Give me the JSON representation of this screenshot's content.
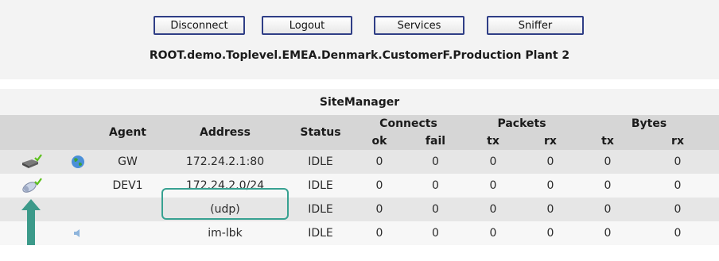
{
  "toolbar": {
    "disconnect_label": "Disconnect",
    "logout_label": "Logout",
    "services_label": "Services",
    "sniffer_label": "Sniffer"
  },
  "breadcrumb": "ROOT.demo.Toplevel.EMEA.Denmark.CustomerF.Production Plant 2",
  "table": {
    "title": "SiteManager",
    "headers": {
      "agent": "Agent",
      "address": "Address",
      "status": "Status",
      "connects": "Connects",
      "packets": "Packets",
      "bytes": "Bytes",
      "ok": "ok",
      "fail": "fail",
      "tx": "tx",
      "rx": "rx"
    },
    "rows": [
      {
        "agent": "GW",
        "address": "172.24.2.1:80",
        "status": "IDLE",
        "ok": "0",
        "fail": "0",
        "ptx": "0",
        "prx": "0",
        "btx": "0",
        "brx": "0"
      },
      {
        "agent": "DEV1",
        "address": "172.24.2.0/24",
        "status": "IDLE",
        "ok": "0",
        "fail": "0",
        "ptx": "0",
        "prx": "0",
        "btx": "0",
        "brx": "0"
      },
      {
        "agent": "",
        "address": "(udp)",
        "status": "IDLE",
        "ok": "0",
        "fail": "0",
        "ptx": "0",
        "prx": "0",
        "btx": "0",
        "brx": "0"
      },
      {
        "agent": "",
        "address": "im-lbk",
        "status": "IDLE",
        "ok": "0",
        "fail": "0",
        "ptx": "0",
        "prx": "0",
        "btx": "0",
        "brx": "0"
      }
    ]
  },
  "icons": {
    "row1_device": "gateway-check-icon",
    "row1_globe": "globe-icon",
    "row2_device": "device-check-icon",
    "row3_arrow": "up-arrow-icon",
    "row4_speaker": "speaker-icon"
  },
  "colors": {
    "button_border": "#2f3e86",
    "highlight": "#37a191",
    "header_bg": "#d6d6d6",
    "arrow": "#3c9a8a"
  }
}
